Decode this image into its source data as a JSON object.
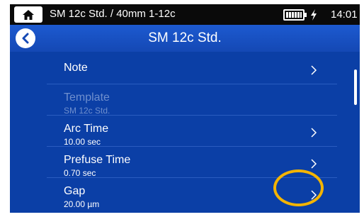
{
  "status_bar": {
    "breadcrumb": "SM 12c Std. / 40mm 1-12c",
    "time": "14:01",
    "home_icon": "home-icon",
    "battery_icon": "battery-icon",
    "charge_icon": "charging-bolt-icon"
  },
  "header": {
    "title": "SM 12c Std.",
    "back_icon": "back-arrow-icon"
  },
  "items": [
    {
      "label": "Note",
      "value": "",
      "enabled": true
    },
    {
      "label": "Template",
      "value": "SM 12c Std.",
      "enabled": false
    },
    {
      "label": "Arc Time",
      "value": "10.00 sec",
      "enabled": true,
      "highlighted": true
    },
    {
      "label": "Prefuse Time",
      "value": "0.70 sec",
      "enabled": true
    },
    {
      "label": "Gap",
      "value": "20.00 µm",
      "enabled": true
    }
  ],
  "colors": {
    "background": "#0b3fa6",
    "header": "#1448b4",
    "status_bar": "#0a0a0a",
    "highlight": "#f4b400",
    "disabled_text": "#6f8fce"
  }
}
